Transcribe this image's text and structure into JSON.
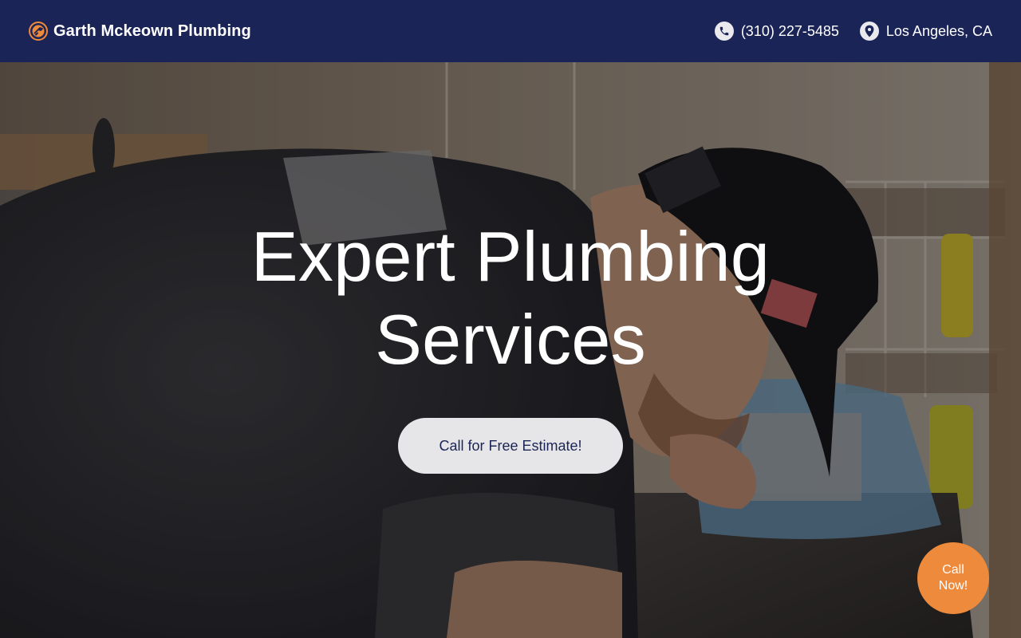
{
  "header": {
    "brand_name": "Garth Mckeown Plumbing",
    "logo_icon": "wrench-logo-icon",
    "phone": "(310) 227-5485",
    "phone_icon": "phone-icon",
    "location": "Los Angeles, CA",
    "location_icon": "map-pin-icon"
  },
  "hero": {
    "title_line1": "Expert Plumbing",
    "title_line2": "Services",
    "cta_label": "Call for Free Estimate!"
  },
  "floating_call": {
    "line1": "Call",
    "line2": "Now!"
  },
  "colors": {
    "header_bg": "#1b2456",
    "accent_orange": "#ee8a3b",
    "cta_bg": "#e6e6e9",
    "cta_text": "#1b2456"
  }
}
